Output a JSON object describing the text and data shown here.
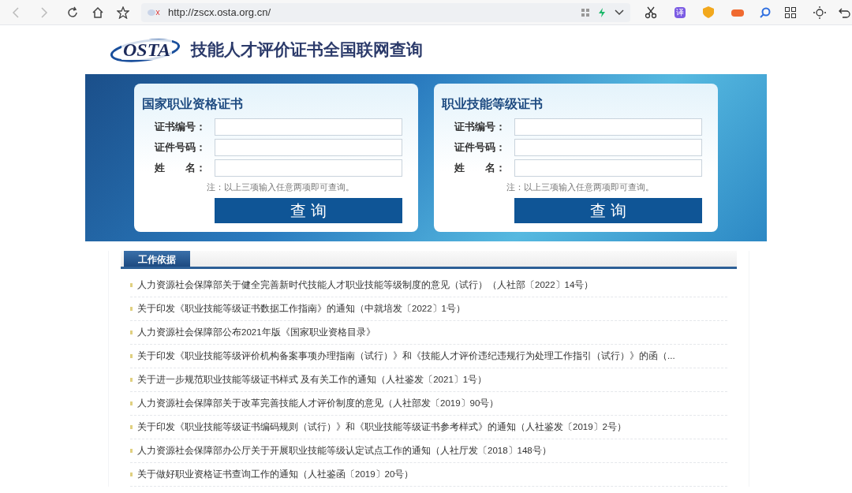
{
  "browser": {
    "url": "http://zscx.osta.org.cn/",
    "translate_label": "译"
  },
  "header": {
    "logo": "OSTA",
    "title": "技能人才评价证书全国联网查询"
  },
  "panels": [
    {
      "title": "国家职业资格证书",
      "fields": [
        {
          "label": "证书编号："
        },
        {
          "label": "证件号码："
        },
        {
          "label": "姓　　名："
        }
      ],
      "note": "注：以上三项输入任意两项即可查询。",
      "button": "查 询"
    },
    {
      "title": "职业技能等级证书",
      "fields": [
        {
          "label": "证书编号："
        },
        {
          "label": "证件号码："
        },
        {
          "label": "姓　　名："
        }
      ],
      "note": "注：以上三项输入任意两项即可查询。",
      "button": "查 询"
    }
  ],
  "section": {
    "tab": "工作依据",
    "items": [
      "人力资源社会保障部关于健全完善新时代技能人才职业技能等级制度的意见（试行）（人社部〔2022〕14号）",
      "关于印发《职业技能等级证书数据工作指南》的通知（中就培发〔2022〕1号）",
      "人力资源社会保障部公布2021年版《国家职业资格目录》",
      "关于印发《职业技能等级评价机构备案事项办理指南（试行）》和《技能人才评价违纪违规行为处理工作指引（试行）》的函（...",
      "关于进一步规范职业技能等级证书样式 及有关工作的通知（人社鉴发〔2021〕1号）",
      "人力资源社会保障部关于改革完善技能人才评价制度的意见（人社部发〔2019〕90号）",
      "关于印发《职业技能等级证书编码规则（试行）》和《职业技能等级证书参考样式》的通知（人社鉴发〔2019〕2号）",
      "人力资源社会保障部办公厅关于开展职业技能等级认定试点工作的通知（人社厅发〔2018〕148号）",
      "关于做好职业资格证书查询工作的通知（人社鉴函〔2019〕20号）"
    ]
  }
}
